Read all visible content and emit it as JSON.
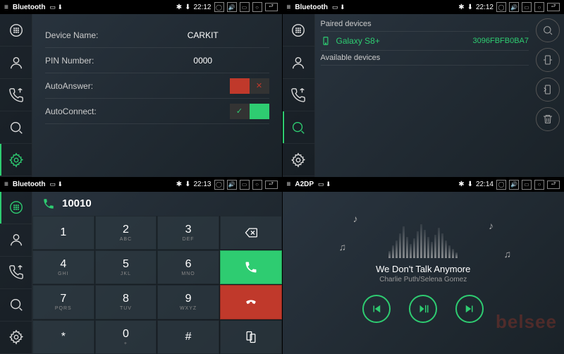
{
  "tl": {
    "title": "Bluetooth",
    "time": "22:12",
    "settings": {
      "device_label": "Device Name:",
      "device_value": "CARKIT",
      "pin_label": "PIN Number:",
      "pin_value": "0000",
      "auto_answer_label": "AutoAnswer:",
      "auto_answer": false,
      "auto_connect_label": "AutoConnect:",
      "auto_connect": true
    }
  },
  "tr": {
    "title": "Bluetooth",
    "time": "22:12",
    "paired_header": "Paired devices",
    "available_header": "Available devices",
    "paired": [
      {
        "name": "Galaxy S8+",
        "mac": "3096FBFB0BA7"
      }
    ]
  },
  "bl": {
    "title": "Bluetooth",
    "time": "22:13",
    "number": "10010",
    "keys": {
      "1": "1",
      "2": "2",
      "3": "3",
      "4": "4",
      "5": "5",
      "6": "6",
      "7": "7",
      "8": "8",
      "9": "9",
      "0": "0",
      "star": "*",
      "hash": "#",
      "sub2": "ABC",
      "sub3": "DEF",
      "sub4": "GHI",
      "sub5": "JKL",
      "sub6": "MNO",
      "sub7": "PQRS",
      "sub8": "TUV",
      "sub9": "WXYZ",
      "sub0": "+"
    }
  },
  "br": {
    "title": "A2DP",
    "time": "22:14",
    "track": "We Don't Talk Anymore",
    "artist": "Charlie Puth/Selena Gomez",
    "watermark": "belsee"
  }
}
